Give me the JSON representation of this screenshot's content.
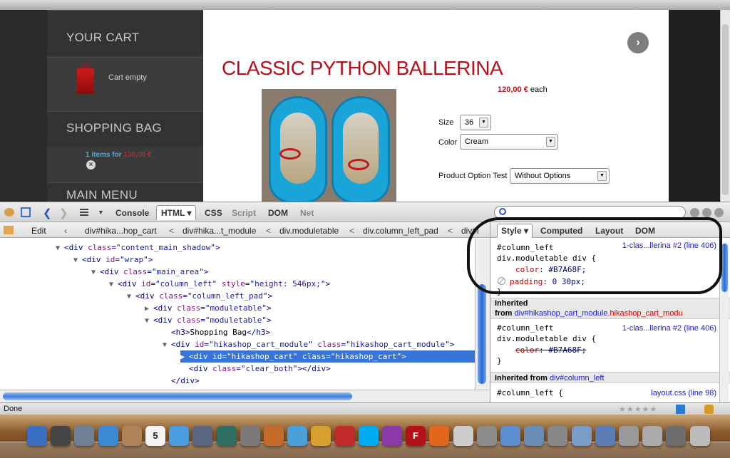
{
  "webpage": {
    "sidebar": {
      "cart_heading": "YOUR CART",
      "cart_empty": "Cart empty",
      "shopping_bag_heading": "SHOPPING BAG",
      "items_text": "1 items for",
      "items_price": "120,00 €",
      "main_menu_heading": "MAIN MENU"
    },
    "product": {
      "title": "CLASSIC PYTHON BALLERINA",
      "price": "120,00 €",
      "price_suffix": "each",
      "size_label": "Size",
      "size_value": "36",
      "color_label": "Color",
      "color_value": "Cream",
      "option_label": "Product Option Test",
      "option_value": "Without Options"
    },
    "colors": {
      "accent": "#B7101C",
      "sidebar": "#3A3A3A",
      "link_blue": "#4FA9D8"
    }
  },
  "firebug": {
    "tabs": [
      "Console",
      "HTML",
      "CSS",
      "Script",
      "DOM",
      "Net"
    ],
    "active_tab": "HTML",
    "edit_label": "Edit",
    "breadcrumbs": [
      "div#hika...hop_cart",
      "div#hika...t_module",
      "div.moduletable",
      "div.column_left_pad",
      "div#i"
    ],
    "html_tree": [
      {
        "indent": 0,
        "tw": "▼",
        "tag": "div",
        "attrs": [
          [
            "class",
            "content_main_shadow"
          ]
        ],
        "close": false,
        "text": ""
      },
      {
        "indent": 1,
        "tw": "▼",
        "tag": "div",
        "attrs": [
          [
            "id",
            "wrap"
          ]
        ],
        "close": false,
        "text": ""
      },
      {
        "indent": 2,
        "tw": "▼",
        "tag": "div",
        "attrs": [
          [
            "class",
            "main_area"
          ]
        ],
        "close": false,
        "text": ""
      },
      {
        "indent": 3,
        "tw": "▼",
        "tag": "div",
        "attrs": [
          [
            "id",
            "column_left"
          ],
          [
            "style",
            "height: 546px;"
          ]
        ],
        "close": false,
        "text": ""
      },
      {
        "indent": 4,
        "tw": "▼",
        "tag": "div",
        "attrs": [
          [
            "class",
            "column_left_pad"
          ]
        ],
        "close": false,
        "text": ""
      },
      {
        "indent": 5,
        "tw": "▶",
        "tag": "div",
        "attrs": [
          [
            "class",
            "moduletable"
          ]
        ],
        "close": false,
        "text": ""
      },
      {
        "indent": 5,
        "tw": "▼",
        "tag": "div",
        "attrs": [
          [
            "class",
            "moduletable"
          ]
        ],
        "close": false,
        "text": ""
      },
      {
        "indent": 6,
        "tw": "",
        "tag": "h3",
        "attrs": [],
        "close": true,
        "text": "Shopping Bag"
      },
      {
        "indent": 6,
        "tw": "▼",
        "tag": "div",
        "attrs": [
          [
            "id",
            "hikashop_cart_module"
          ],
          [
            "class",
            "hikashop_cart_module"
          ]
        ],
        "close": false,
        "text": ""
      },
      {
        "indent": 7,
        "tw": "▶",
        "tag": "div",
        "attrs": [
          [
            "id",
            "hikashop_cart"
          ],
          [
            "class",
            "hikashop_cart"
          ]
        ],
        "close": false,
        "text": "",
        "selected": true
      },
      {
        "indent": 7,
        "tw": "",
        "tag": "div",
        "attrs": [
          [
            "class",
            "clear_both"
          ]
        ],
        "close": true,
        "text": ""
      },
      {
        "indent": 6,
        "tw": "",
        "tag": "/div",
        "attrs": [],
        "close": false,
        "text": ""
      },
      {
        "indent": 5,
        "tw": "",
        "tag": "/div",
        "attrs": [],
        "close": false,
        "text": ""
      }
    ],
    "side_tabs": [
      "Style",
      "Computed",
      "Layout",
      "DOM"
    ],
    "active_side_tab": "Style",
    "rules": {
      "rule1": {
        "selector1": "#column_left",
        "selector2": "div.moduletable div {",
        "source": "1-clas...llerina #2 (line 406)",
        "prop1": "color",
        "val1": "#B7A68F;",
        "prop2": "padding",
        "val2": "0 30px;",
        "close": "}"
      },
      "inherited1": {
        "label": "Inherited",
        "from": "from",
        "link": "div#hikashop_cart_module",
        "link_red": ".hikashop_cart_modu"
      },
      "rule2": {
        "selector1": "#column_left",
        "selector2": "div.moduletable div {",
        "source": "1-clas...llerina #2 (line 406)",
        "prop1": "color",
        "val1": "#B7A68F;",
        "close": "}"
      },
      "inherited2": {
        "label": "Inherited from",
        "link": "div#column_left"
      },
      "rule3": {
        "selector1": "#column_left {",
        "source": "layout.css (line 98)"
      }
    }
  },
  "status": {
    "text": "Done"
  },
  "dock": {
    "icons": [
      "finder-icon",
      "dashboard-icon",
      "mail-icon",
      "safari-icon",
      "address-book-icon",
      "ical-icon",
      "itunes-icon",
      "spaces-icon",
      "time-machine-icon",
      "system-preferences-icon",
      "preview-icon",
      "ink-icon",
      "flower-icon",
      "acrobat-icon",
      "skype-icon",
      "textmate-icon",
      "filezilla-icon",
      "firefox-icon",
      "script-editor-icon",
      "disk-utility-icon",
      "finder-window-icon",
      "image-capture-icon",
      "screen-icon",
      "folder-icon",
      "downloads-icon",
      "calculator-icon",
      "display-icon",
      "stack-icon",
      "trash-icon"
    ],
    "filezilla_letter": "F",
    "ical_day": "5"
  }
}
